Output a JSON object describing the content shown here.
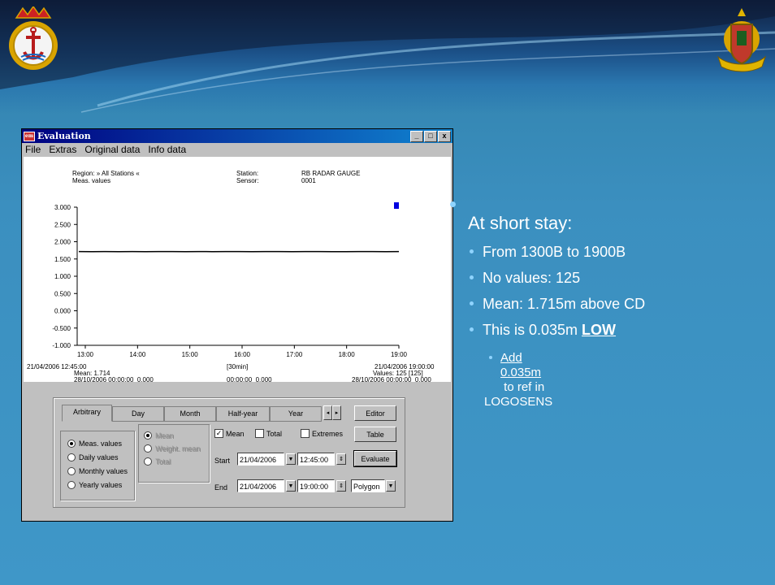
{
  "window": {
    "title": "Evaluation",
    "menu": [
      "File",
      "Extras",
      "Original data",
      "Info data"
    ],
    "controls": [
      "_",
      "□",
      "x"
    ]
  },
  "header": {
    "region_label": "Region: » All Stations «",
    "meas_label": "Meas. values",
    "station_label": "Station:",
    "station_value": "RB RADAR GAUGE",
    "sensor_label": "Sensor:",
    "sensor_value": "0001"
  },
  "chart_data": {
    "type": "line",
    "y_ticks": [
      "3.000",
      "2.500",
      "2.000",
      "1.500",
      "1.000",
      "0.500",
      "0.000",
      "-0.500",
      "-1.000"
    ],
    "ylim": [
      -1.0,
      3.0
    ],
    "x_ticks": [
      "13:00",
      "14:00",
      "15:00",
      "16:00",
      "17:00",
      "18:00",
      "19:00"
    ],
    "series": [
      {
        "values": [
          1.715,
          1.714,
          1.716,
          1.713,
          1.715,
          1.714,
          1.716,
          1.715,
          1.714,
          1.715,
          1.713,
          1.715,
          1.716,
          1.714,
          1.715,
          1.715,
          1.714,
          1.716,
          1.715,
          1.714,
          1.713,
          1.715,
          1.716,
          1.714,
          1.715
        ]
      }
    ],
    "annotations": {
      "start_datetime": "21/04/2006 12:45:00",
      "mean": "Mean: 1.714",
      "bottom_left": "28/10/2006 00:00:00  0.000",
      "interval": "[30min]",
      "bottom_mid": "00:00:00  0.000",
      "end_datetime": "21/04/2006 19:00:00",
      "values": "Values: 125 [125]",
      "bottom_right": "28/10/2006 00:00:00  0.000"
    }
  },
  "tabs": [
    "Arbitrary",
    "Day",
    "Month",
    "Half-year",
    "Year"
  ],
  "buttons": {
    "editor": "Editor",
    "table": "Table",
    "evaluate": "Evaluate"
  },
  "radios": [
    "Meas. values",
    "Daily values",
    "Monthly values",
    "Yearly values"
  ],
  "radios_disabled": [
    "Mean",
    "Weight. mean",
    "Total"
  ],
  "checks": [
    {
      "label": "Mean",
      "checked": true
    },
    {
      "label": "Total",
      "checked": false
    },
    {
      "label": "Extremes",
      "checked": false
    }
  ],
  "start": {
    "label": "Start",
    "date": "21/04/2006",
    "time": "12:45:00"
  },
  "end": {
    "label": "End",
    "date": "21/04/2006",
    "time": "19:00:00",
    "mode": "Polygon"
  },
  "notes": {
    "heading": "At short stay:",
    "items": [
      "From 1300B to 1900B",
      "No values: 125",
      "Mean: 1.715m above CD"
    ],
    "low_prefix": "This is 0.035m ",
    "low_word": "LOW",
    "sub_underlined": "Add 0.035m",
    "sub_rest": " to ref in",
    "sub_line2": "LOGOSENS"
  }
}
